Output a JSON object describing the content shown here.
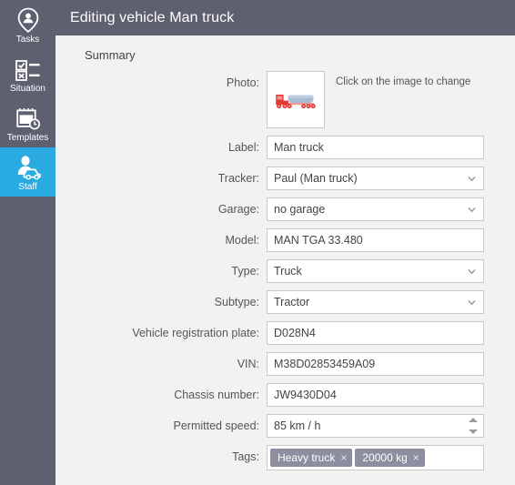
{
  "sidebar": {
    "items": [
      {
        "label": "Tasks",
        "icon": "person-pin-icon",
        "active": false
      },
      {
        "label": "Situation",
        "icon": "checklist-icon",
        "active": false
      },
      {
        "label": "Templates",
        "icon": "calendar-clock-icon",
        "active": false
      },
      {
        "label": "Staff",
        "icon": "person-car-icon",
        "active": true
      }
    ],
    "active_color": "#29abe2",
    "background_color": "#5e6070"
  },
  "titlebar": {
    "title": "Editing vehicle Man truck",
    "background_color": "#5e6070"
  },
  "form": {
    "section_title": "Summary",
    "photo": {
      "label": "Photo:",
      "hint": "Click on the image to change",
      "icon": "tanker-truck-image"
    },
    "fields": [
      {
        "label": "Label:",
        "value": "Man truck",
        "type": "text"
      },
      {
        "label": "Tracker:",
        "value": "Paul (Man truck)",
        "type": "select"
      },
      {
        "label": "Garage:",
        "value": "no garage",
        "type": "select"
      },
      {
        "label": "Model:",
        "value": "MAN TGA 33.480",
        "type": "text"
      },
      {
        "label": "Type:",
        "value": "Truck",
        "type": "select"
      },
      {
        "label": "Subtype:",
        "value": "Tractor",
        "type": "select"
      },
      {
        "label": "Vehicle registration plate:",
        "value": "D028N4",
        "type": "text"
      },
      {
        "label": "VIN:",
        "value": "M38D02853459A09",
        "type": "text"
      },
      {
        "label": "Chassis number:",
        "value": "JW9430D04",
        "type": "text"
      },
      {
        "label": "Permitted speed:",
        "value": "85  km / h",
        "type": "spinner"
      }
    ],
    "tags": {
      "label": "Tags:",
      "items": [
        {
          "text": "Heavy truck",
          "remove": "×"
        },
        {
          "text": "20000 kg",
          "remove": "×"
        }
      ],
      "chip_color": "#8d8fa1"
    }
  }
}
